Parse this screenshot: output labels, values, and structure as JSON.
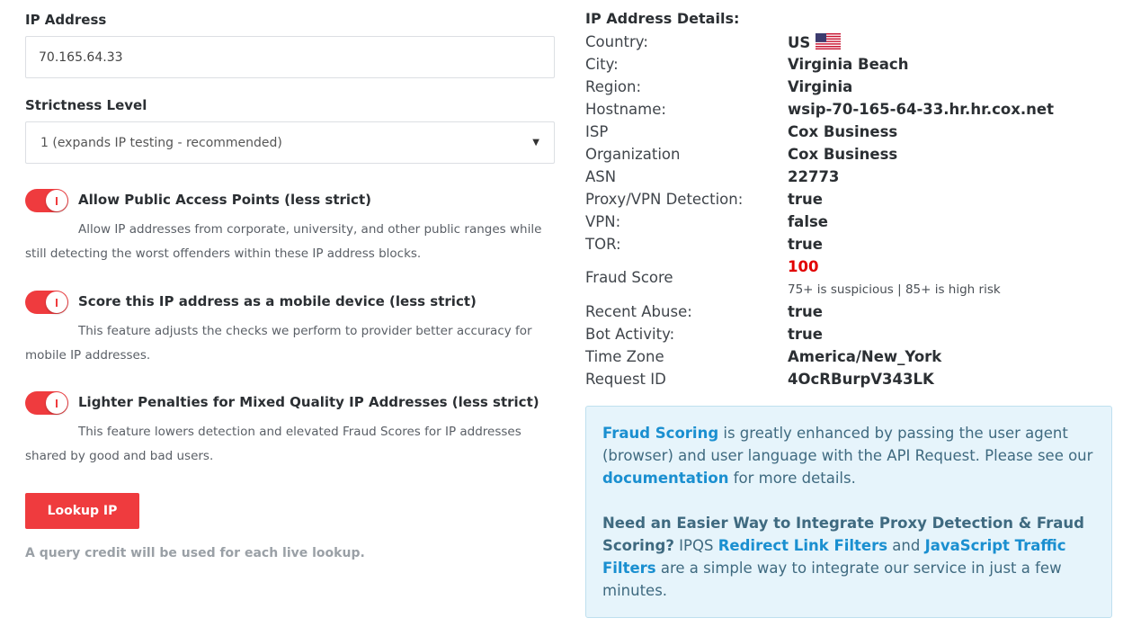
{
  "form": {
    "ip_label": "IP Address",
    "ip_value": "70.165.64.33",
    "strictness_label": "Strictness Level",
    "strictness_selected": "1 (expands IP testing - recommended)",
    "toggles": [
      {
        "title": "Allow Public Access Points (less strict)",
        "description": "Allow IP addresses from corporate, university, and other public ranges while still detecting the worst offenders within these IP address blocks.",
        "enabled": true
      },
      {
        "title": "Score this IP address as a mobile device (less strict)",
        "description": "This feature adjusts the checks we perform to provider better accuracy for mobile IP addresses.",
        "enabled": true
      },
      {
        "title": "Lighter Penalties for Mixed Quality IP Addresses (less strict)",
        "description": "This feature lowers detection and elevated Fraud Scores for IP addresses shared by good and bad users.",
        "enabled": true
      }
    ],
    "lookup_button": "Lookup IP",
    "credit_note": "A query credit will be used for each live lookup."
  },
  "details": {
    "title": "IP Address Details:",
    "country_label": "Country:",
    "country_value": "US",
    "city_label": "City:",
    "city_value": "Virginia Beach",
    "region_label": "Region:",
    "region_value": "Virginia",
    "hostname_label": "Hostname:",
    "hostname_value": "wsip-70-165-64-33.hr.hr.cox.net",
    "isp_label": "ISP",
    "isp_value": "Cox Business",
    "org_label": "Organization",
    "org_value": "Cox Business",
    "asn_label": "ASN",
    "asn_value": "22773",
    "proxy_label": "Proxy/VPN Detection:",
    "proxy_value": "true",
    "vpn_label": "VPN:",
    "vpn_value": "false",
    "tor_label": "TOR:",
    "tor_value": "true",
    "fraud_label": "Fraud Score",
    "fraud_value": "100",
    "fraud_note": "75+ is suspicious | 85+ is high risk",
    "abuse_label": "Recent Abuse:",
    "abuse_value": "true",
    "bot_label": "Bot Activity:",
    "bot_value": "true",
    "tz_label": "Time Zone",
    "tz_value": "America/New_York",
    "reqid_label": "Request ID",
    "reqid_value": "4OcRBurpV343LK"
  },
  "info": {
    "p1_link1": "Fraud Scoring",
    "p1_text1": " is greatly enhanced by passing the user agent (browser) and user language with the API Request. Please see our ",
    "p1_link2": "documentation",
    "p1_text2": " for more details.",
    "p2_strong": "Need an Easier Way to Integrate Proxy Detection & Fraud Scoring?",
    "p2_text1": " IPQS ",
    "p2_link1": "Redirect Link Filters",
    "p2_text2": " and ",
    "p2_link2": "JavaScript Traffic Filters",
    "p2_text3": " are a simple way to integrate our service in just a few minutes."
  },
  "colors": {
    "accent": "#ef3b3e",
    "fraud_score": "#e10000",
    "info_bg": "#e6f4fb",
    "link": "#1a8fd0"
  },
  "icons": {
    "flag": "us-flag-icon",
    "caret": "chevron-down-icon",
    "toggle": "toggle-switch"
  }
}
